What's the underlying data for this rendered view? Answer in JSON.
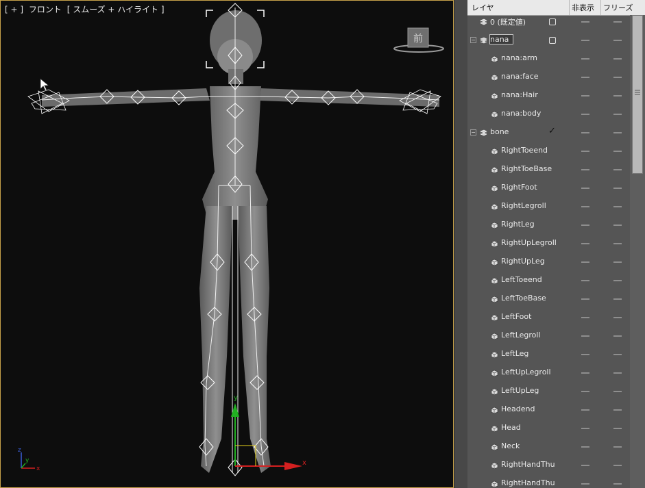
{
  "viewport": {
    "label_parts": [
      "[ + ]",
      "フロント",
      "[ スムーズ + ハイライト ]"
    ],
    "viewcube_label": "前"
  },
  "layer_panel": {
    "columns": {
      "layer": "レイヤ",
      "hide": "非表示",
      "freeze": "フリーズ"
    },
    "rows": [
      {
        "name": "0 (既定値)",
        "indent": 1,
        "type": "layer",
        "hidden_mark": "box"
      },
      {
        "name": "nana",
        "indent": 0,
        "type": "layer",
        "expander": "−",
        "selected": true,
        "hidden_mark": "box"
      },
      {
        "name": "nana:arm",
        "indent": 2,
        "type": "object"
      },
      {
        "name": "nana:face",
        "indent": 2,
        "type": "object"
      },
      {
        "name": "nana:Hair",
        "indent": 2,
        "type": "object"
      },
      {
        "name": "nana:body",
        "indent": 2,
        "type": "object"
      },
      {
        "name": "bone",
        "indent": 0,
        "type": "layer",
        "expander": "−",
        "hidden_mark": "check"
      },
      {
        "name": "RightToeend",
        "indent": 2,
        "type": "object"
      },
      {
        "name": "RightToeBase",
        "indent": 2,
        "type": "object"
      },
      {
        "name": "RightFoot",
        "indent": 2,
        "type": "object"
      },
      {
        "name": "RightLegroll",
        "indent": 2,
        "type": "object"
      },
      {
        "name": "RightLeg",
        "indent": 2,
        "type": "object"
      },
      {
        "name": "RightUpLegroll",
        "indent": 2,
        "type": "object"
      },
      {
        "name": "RightUpLeg",
        "indent": 2,
        "type": "object"
      },
      {
        "name": "LeftToeend",
        "indent": 2,
        "type": "object"
      },
      {
        "name": "LeftToeBase",
        "indent": 2,
        "type": "object"
      },
      {
        "name": "LeftFoot",
        "indent": 2,
        "type": "object"
      },
      {
        "name": "LeftLegroll",
        "indent": 2,
        "type": "object"
      },
      {
        "name": "LeftLeg",
        "indent": 2,
        "type": "object"
      },
      {
        "name": "LeftUpLegroll",
        "indent": 2,
        "type": "object"
      },
      {
        "name": "LeftUpLeg",
        "indent": 2,
        "type": "object"
      },
      {
        "name": "Headend",
        "indent": 2,
        "type": "object"
      },
      {
        "name": "Head",
        "indent": 2,
        "type": "object"
      },
      {
        "name": "Neck",
        "indent": 2,
        "type": "object"
      },
      {
        "name": "RightHandThu",
        "indent": 2,
        "type": "object"
      },
      {
        "name": "RightHandThu",
        "indent": 2,
        "type": "object"
      }
    ]
  },
  "axes": {
    "x": "x",
    "y": "y",
    "z": "z"
  },
  "colors": {
    "viewport_border": "#c8a24a",
    "axis_x": "#d42020",
    "axis_y": "#22b022",
    "gizmo_yellow": "#e8d21a"
  }
}
